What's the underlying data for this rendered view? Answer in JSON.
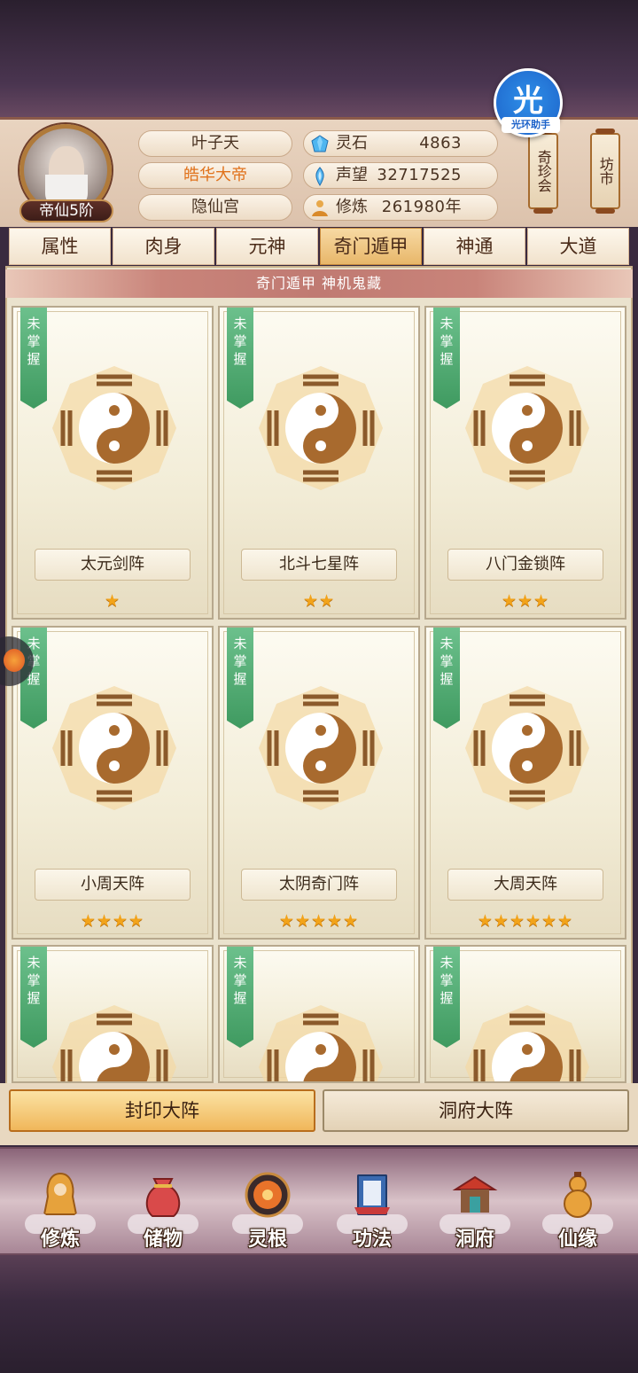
{
  "helper": {
    "big": "光",
    "small": "光环助手"
  },
  "player": {
    "rank": "帝仙5阶",
    "name": "叶子天",
    "title": "皓华大帝",
    "sect": "隐仙宫"
  },
  "stats": [
    {
      "icon": "spirit-stone-icon",
      "label": "灵石",
      "value": "4863"
    },
    {
      "icon": "reputation-icon",
      "label": "声望",
      "value": "32717525"
    },
    {
      "icon": "cultivation-icon",
      "label": "修炼",
      "value": "261980年"
    }
  ],
  "side_buttons": {
    "treasure": "奇珍会",
    "market": "坊市"
  },
  "tabs": [
    "属性",
    "肉身",
    "元神",
    "奇门遁甲",
    "神通",
    "大道"
  ],
  "active_tab": "奇门遁甲",
  "subtitle": "奇门遁甲  神机鬼藏",
  "formations": [
    {
      "status": "未掌握",
      "name": "太元剑阵",
      "stars": "★"
    },
    {
      "status": "未掌握",
      "name": "北斗七星阵",
      "stars": "★★"
    },
    {
      "status": "未掌握",
      "name": "八门金锁阵",
      "stars": "★★★"
    },
    {
      "status": "未掌握",
      "name": "小周天阵",
      "stars": "★★★★"
    },
    {
      "status": "未掌握",
      "name": "太阴奇门阵",
      "stars": "★★★★★"
    },
    {
      "status": "未掌握",
      "name": "大周天阵",
      "stars": "★★★★★★"
    },
    {
      "status": "未掌握",
      "name": "",
      "stars": ""
    },
    {
      "status": "未掌握",
      "name": "",
      "stars": ""
    },
    {
      "status": "未掌握",
      "name": "",
      "stars": ""
    }
  ],
  "actions": {
    "primary": "封印大阵",
    "secondary": "洞府大阵"
  },
  "nav": [
    {
      "icon": "meditate-icon",
      "label": "修炼"
    },
    {
      "icon": "storage-bag-icon",
      "label": "储物"
    },
    {
      "icon": "spirit-root-icon",
      "label": "灵根"
    },
    {
      "icon": "technique-book-icon",
      "label": "功法"
    },
    {
      "icon": "cave-abode-icon",
      "label": "洞府"
    },
    {
      "icon": "fate-gourd-icon",
      "label": "仙缘"
    }
  ],
  "colors": {
    "accent_gold": "#f0b75a",
    "ribbon_green": "#3f9a60",
    "star": "#f2a31a",
    "title_orange": "#e0721c"
  }
}
